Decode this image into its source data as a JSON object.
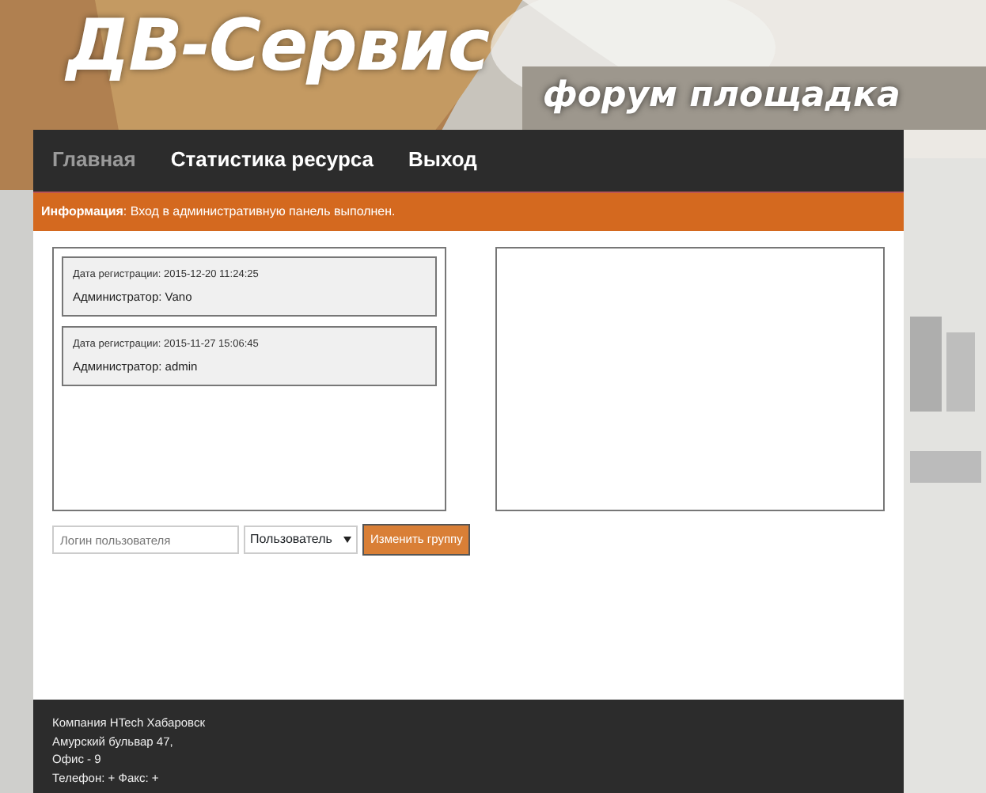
{
  "header": {
    "title": "ДВ-Сервис",
    "subtitle": "форум площадка"
  },
  "nav": [
    {
      "label": "Главная",
      "selected": true
    },
    {
      "label": "Статистика ресурса",
      "selected": false
    },
    {
      "label": "Выход",
      "selected": false
    }
  ],
  "alert": {
    "label": "Информация",
    "text": ": Вход в административную панель выполнен."
  },
  "users": [
    {
      "date": "Дата регистрации: 2015-12-20 11:24:25",
      "role": "Администратор: Vano"
    },
    {
      "date": "Дата регистрации: 2015-11-27 15:06:45",
      "role": "Администратор: admin"
    }
  ],
  "form": {
    "login_placeholder": "Логин пользователя",
    "group": "Пользователь",
    "button": "Изменить группу"
  },
  "footer": [
    "Компания HTech Хабаровск",
    "Амурский бульвар 47,",
    "Офис - 9",
    "Телефон: + Факс: +"
  ]
}
